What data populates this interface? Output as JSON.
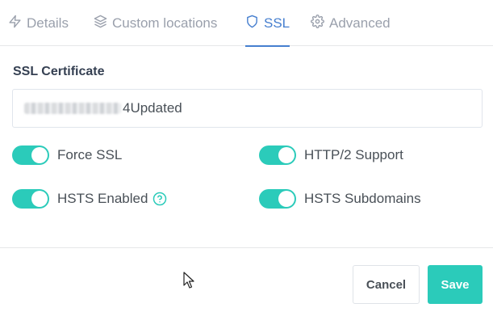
{
  "tabs": [
    {
      "label": "Details",
      "icon": "bolt-icon",
      "active": false
    },
    {
      "label": "Custom locations",
      "icon": "layers-icon",
      "active": false
    },
    {
      "label": "SSL",
      "icon": "shield-icon",
      "active": true
    },
    {
      "label": "Advanced",
      "icon": "gear-icon",
      "active": false
    }
  ],
  "ssl": {
    "label": "SSL Certificate",
    "certificate_value_visible": "4Updated"
  },
  "toggles": {
    "force_ssl": {
      "label": "Force SSL",
      "enabled": true
    },
    "http2": {
      "label": "HTTP/2 Support",
      "enabled": true
    },
    "hsts": {
      "label": "HSTS Enabled",
      "enabled": true
    },
    "hsts_subdomains": {
      "label": "HSTS Subdomains",
      "enabled": true
    }
  },
  "buttons": {
    "cancel": "Cancel",
    "save": "Save"
  },
  "colors": {
    "accent": "#467fcf",
    "toggle_on": "#2bcbba",
    "save": "#2bcbba"
  }
}
